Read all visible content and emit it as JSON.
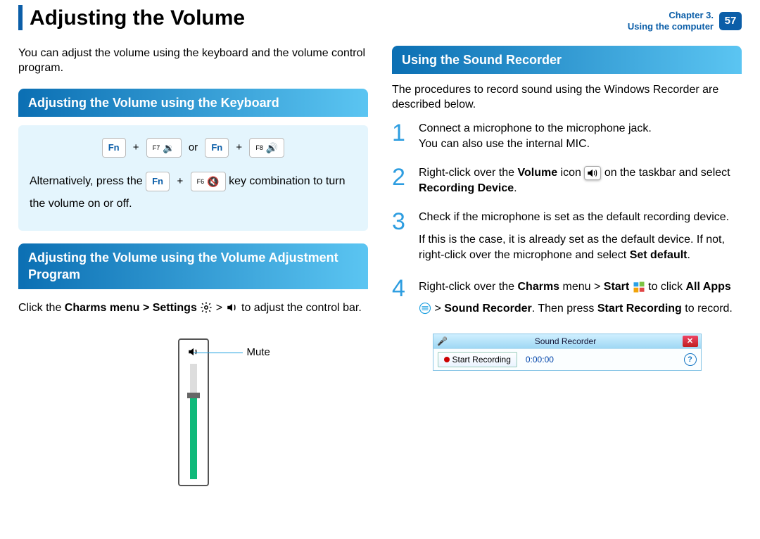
{
  "header": {
    "title": "Adjusting the Volume",
    "chapter": "Chapter 3.",
    "section": "Using the computer",
    "page": "57"
  },
  "left": {
    "intro": "You can adjust the volume using the keyboard and the volume control program.",
    "sect1": "Adjusting the Volume using the Keyboard",
    "keys": {
      "fn": "Fn",
      "f7": "F7",
      "f8": "F8",
      "f6": "F6",
      "plus": "+",
      "or": "or"
    },
    "alt_pre": "Alternatively, press the ",
    "alt_post": " key combination to turn the volume on or off.",
    "sect2": "Adjusting the Volume using the Volume Adjustment Program",
    "charms1": "Click the ",
    "charms_bold": "Charms menu > Settings",
    "charms2": " > ",
    "charms3": " to adjust the control bar.",
    "mute_label": "Mute"
  },
  "right": {
    "sect1": "Using the Sound Recorder",
    "intro": "The procedures to record sound using the Windows Recorder are described below.",
    "steps": {
      "s1": {
        "num": "1",
        "a": "Connect a microphone to the microphone jack.",
        "b": "You can also use the internal MIC."
      },
      "s2": {
        "num": "2",
        "pre": "Right-click over the ",
        "vol": "Volume",
        "mid": " icon ",
        "post": " on the taskbar and select ",
        "rd": "Recording Device",
        "dot": "."
      },
      "s3": {
        "num": "3",
        "a": "Check if the microphone is set as the default recording device.",
        "b1": "If this is the case, it is already set as the default device. If not, right-click over the microphone and select ",
        "sd": "Set default",
        "dot": "."
      },
      "s4": {
        "num": "4",
        "pre": "Right-click over the ",
        "cm": "Charms",
        "mid1": " menu > ",
        "start": "Start",
        "mid2": " to click ",
        "all": "All Apps",
        "mid3": " > ",
        "sr": "Sound Recorder",
        "mid4": ". Then press ",
        "srbtn": "Start Recording",
        "post": " to record."
      }
    },
    "window": {
      "title": "Sound Recorder",
      "btn": "Start Recording",
      "time": "0:00:00",
      "close": "✕",
      "help": "?"
    }
  }
}
